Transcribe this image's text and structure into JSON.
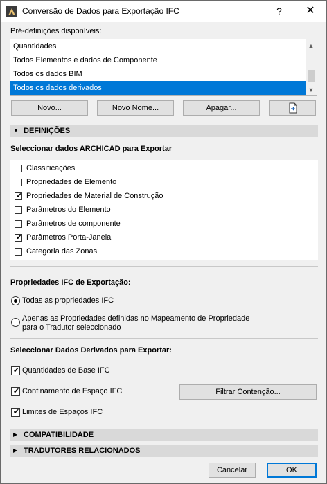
{
  "window": {
    "title": "Conversão de Dados para Exportação IFC",
    "help_label": "?",
    "close_label": "✕"
  },
  "presets": {
    "label": "Pré-definições disponíveis:",
    "items": [
      "Quantidades",
      "Todos Elementos e dados de Componente",
      "Todos os dados BIM",
      "Todos os dados derivados"
    ],
    "selected_index": 3,
    "buttons": {
      "new": "Novo...",
      "new_name": "Novo Nome...",
      "delete": "Apagar..."
    }
  },
  "definitions": {
    "header": "DEFINIÇÕES",
    "select_label": "Seleccionar dados ARCHICAD para Exportar",
    "items": [
      {
        "label": "Classificações",
        "checked": false
      },
      {
        "label": "Propriedades de Elemento",
        "checked": false
      },
      {
        "label": "Propriedades de Material de Construção",
        "checked": true
      },
      {
        "label": "Parâmetros do Elemento",
        "checked": false
      },
      {
        "label": "Parâmetros de componente",
        "checked": false
      },
      {
        "label": "Parâmetros Porta-Janela",
        "checked": true
      },
      {
        "label": "Categoria das Zonas",
        "checked": false
      }
    ]
  },
  "ifc_properties": {
    "label": "Propriedades IFC de Exportação:",
    "option_all": "Todas as propriedades IFC",
    "option_mapped_line1": "Apenas as Propriedades definidas no Mapeamento de Propriedade",
    "option_mapped_line2": "para o Tradutor seleccionado",
    "selected": "all"
  },
  "derived": {
    "label": "Seleccionar Dados Derivados para Exportar:",
    "base_quantities": "Quantidades de Base IFC",
    "space_containment": "Confinamento de Espaço IFC",
    "space_boundaries": "Limites de Espaços IFC",
    "filter_button": "Filtrar Contenção..."
  },
  "sections": {
    "compatibility": "COMPATIBILIDADE",
    "translators": "TRADUTORES RELACIONADOS"
  },
  "footer": {
    "cancel": "Cancelar",
    "ok": "OK"
  }
}
